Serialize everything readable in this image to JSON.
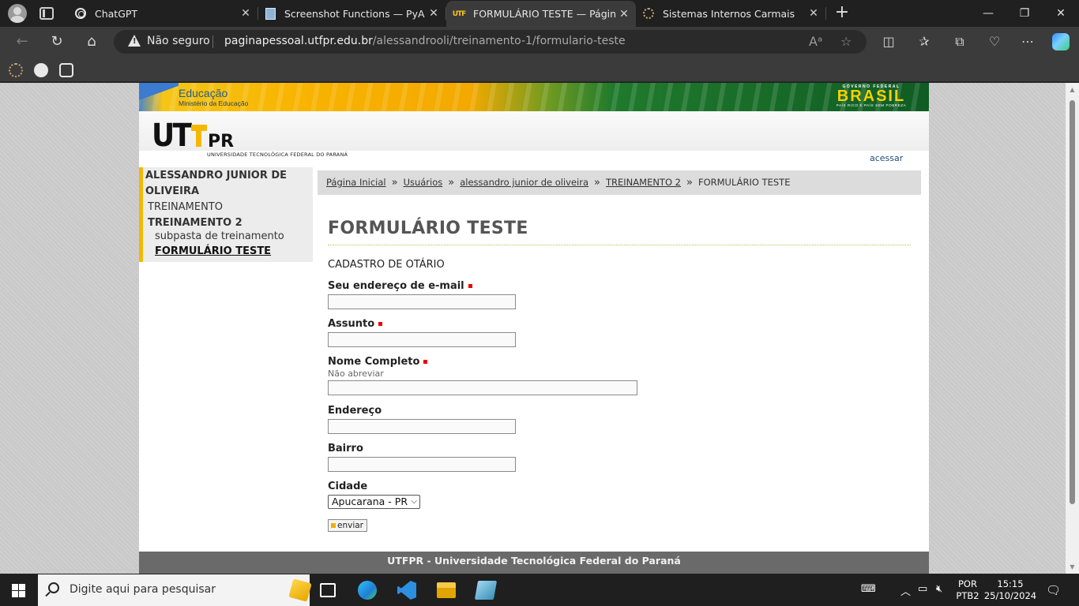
{
  "browser": {
    "tabs": [
      {
        "title": "ChatGPT",
        "favicon": "chatgpt-icon"
      },
      {
        "title": "Screenshot Functions — PyAutoG",
        "favicon": "document-icon"
      },
      {
        "title": "FORMULÁRIO TESTE — Páginas P",
        "favicon": "utfpr-icon",
        "active": true
      },
      {
        "title": "Sistemas Internos Carmais",
        "favicon": "gear-icon"
      }
    ],
    "address": {
      "security_label": "Não seguro",
      "host": "paginapessoal.utfpr.edu.br",
      "path": "/alessandrooli/treinamento-1/formulario-teste"
    }
  },
  "site": {
    "gov_banner": {
      "title": "Educação",
      "subtitle": "Ministério da Educação",
      "gov_label": "GOVERNO FEDERAL",
      "brand": "BRASIL",
      "slogan": "PAÍS RICO É PAÍS SEM POBREZA"
    },
    "logo": {
      "ut": "UT",
      "pr": "PR",
      "name": "UNIVERSIDADE TECNOLÓGICA FEDERAL DO PARANÁ"
    },
    "login_link": "acessar",
    "sidebar": {
      "author": "ALESSANDRO JUNIOR DE OLIVEIRA",
      "items": [
        {
          "label": "TREINAMENTO"
        },
        {
          "label": "TREINAMENTO 2"
        },
        {
          "label": "subpasta de treinamento"
        },
        {
          "label": "FORMULÁRIO TESTE"
        }
      ]
    },
    "breadcrumb": [
      "Página Inicial",
      "Usuários",
      "alessandro junior de oliveira",
      "TREINAMENTO 2",
      "FORMULÁRIO TESTE"
    ],
    "page_title": "FORMULÁRIO TESTE",
    "form": {
      "description": "CADASTRO DE OTÁRIO",
      "fields": [
        {
          "label": "Seu endereço de e-mail",
          "required": true,
          "value": ""
        },
        {
          "label": "Assunto",
          "required": true,
          "value": ""
        },
        {
          "label": "Nome Completo",
          "required": true,
          "help": "Não abreviar",
          "value": ""
        },
        {
          "label": "Endereço",
          "required": false,
          "value": ""
        },
        {
          "label": "Bairro",
          "required": false,
          "value": ""
        },
        {
          "label": "Cidade",
          "required": false,
          "selected": "Apucarana - PR"
        }
      ],
      "submit_label": "enviar"
    },
    "footer": "UTFPR - Universidade Tecnológica Federal do Paraná"
  },
  "taskbar": {
    "search_placeholder": "Digite aqui para pesquisar",
    "lang_top": "POR",
    "lang_bottom": "PTB2",
    "time": "15:15",
    "date": "25/10/2024"
  },
  "colors": {
    "accent_yellow": "#f3b800",
    "required_red": "#ee0000",
    "footer_gray": "#6a6a6a"
  }
}
